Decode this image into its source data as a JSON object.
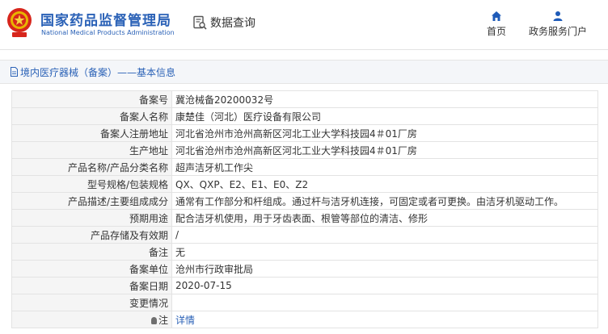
{
  "header": {
    "org_name_cn": "国家药品监督管理局",
    "org_name_en": "National Medical Products Administration",
    "query_label": "数据查询",
    "nav": [
      {
        "label": "首页",
        "icon": "home-icon"
      },
      {
        "label": "政务服务门户",
        "icon": "user-icon"
      }
    ]
  },
  "breadcrumb": "境内医疗器械（备案）——基本信息",
  "fields": [
    {
      "key": "备案号",
      "value": "冀沧械备20200032号"
    },
    {
      "key": "备案人名称",
      "value": "康楚佳（河北）医疗设备有限公司"
    },
    {
      "key": "备案人注册地址",
      "value": "河北省沧州市沧州高新区河北工业大学科技园4＃01厂房"
    },
    {
      "key": "生产地址",
      "value": "河北省沧州市沧州高新区河北工业大学科技园4＃01厂房"
    },
    {
      "key": "产品名称/产品分类名称",
      "value": "超声洁牙机工作尖"
    },
    {
      "key": "型号规格/包装规格",
      "value": "QX、QXP、E2、E1、E0、Z2"
    },
    {
      "key": "产品描述/主要组成成分",
      "value": "通常有工作部分和杆组成。通过杆与洁牙机连接，可固定或者可更换。由洁牙机驱动工作。"
    },
    {
      "key": "预期用途",
      "value": "配合洁牙机使用，用于牙齿表面、根管等部位的清洁、修形"
    },
    {
      "key": "产品存储及有效期",
      "value": "/"
    },
    {
      "key": "备注",
      "value": "无"
    },
    {
      "key": "备案单位",
      "value": "沧州市行政审批局"
    },
    {
      "key": "备案日期",
      "value": "2020-07-15"
    },
    {
      "key": "变更情况",
      "value": ""
    },
    {
      "key": "注",
      "value": "详情"
    }
  ],
  "colors": {
    "brand_blue": "#2b62b7",
    "emblem_red": "#d7261c"
  }
}
